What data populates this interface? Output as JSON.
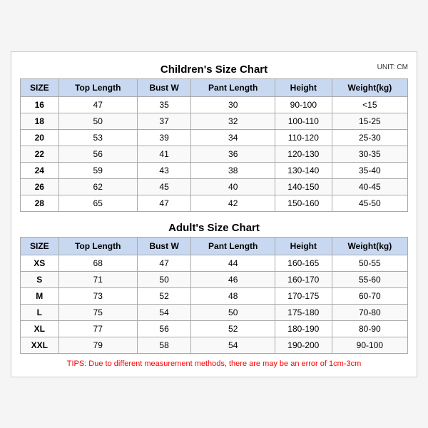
{
  "children_title": "Children's Size Chart",
  "adult_title": "Adult's Size Chart",
  "unit": "UNIT: CM",
  "columns": [
    "SIZE",
    "Top Length",
    "Bust W",
    "Pant Length",
    "Height",
    "Weight(kg)"
  ],
  "children_rows": [
    [
      "16",
      "47",
      "35",
      "30",
      "90-100",
      "<15"
    ],
    [
      "18",
      "50",
      "37",
      "32",
      "100-110",
      "15-25"
    ],
    [
      "20",
      "53",
      "39",
      "34",
      "110-120",
      "25-30"
    ],
    [
      "22",
      "56",
      "41",
      "36",
      "120-130",
      "30-35"
    ],
    [
      "24",
      "59",
      "43",
      "38",
      "130-140",
      "35-40"
    ],
    [
      "26",
      "62",
      "45",
      "40",
      "140-150",
      "40-45"
    ],
    [
      "28",
      "65",
      "47",
      "42",
      "150-160",
      "45-50"
    ]
  ],
  "adult_rows": [
    [
      "XS",
      "68",
      "47",
      "44",
      "160-165",
      "50-55"
    ],
    [
      "S",
      "71",
      "50",
      "46",
      "160-170",
      "55-60"
    ],
    [
      "M",
      "73",
      "52",
      "48",
      "170-175",
      "60-70"
    ],
    [
      "L",
      "75",
      "54",
      "50",
      "175-180",
      "70-80"
    ],
    [
      "XL",
      "77",
      "56",
      "52",
      "180-190",
      "80-90"
    ],
    [
      "XXL",
      "79",
      "58",
      "54",
      "190-200",
      "90-100"
    ]
  ],
  "tips": "TIPS: Due to different measurement methods, there are may be an error of 1cm-3cm"
}
